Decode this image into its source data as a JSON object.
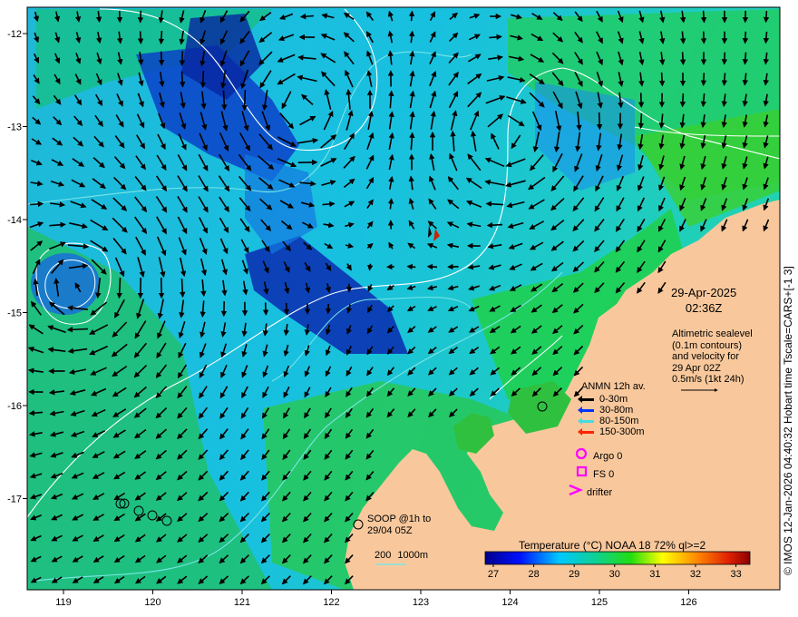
{
  "map": {
    "x_ticks": [
      "119",
      "120",
      "121",
      "122",
      "123",
      "124",
      "125",
      "126"
    ],
    "y_ticks": [
      "-12",
      "-13",
      "-14",
      "-15",
      "-16",
      "-17"
    ]
  },
  "date": {
    "day": "29-Apr-2025",
    "time": "02:36Z"
  },
  "altimetry_note": [
    "Altimetric sealevel",
    "(0.1m contours)",
    "and velocity for",
    "29 Apr 02Z",
    "0.5m/s (1kt 24h)"
  ],
  "anmn_legend": {
    "title": "ANMN 12h av.",
    "items": [
      {
        "label": "0-30m",
        "color": "#000000"
      },
      {
        "label": "30-80m",
        "color": "#0033ff"
      },
      {
        "label": "80-150m",
        "color": "#44dddd"
      },
      {
        "label": "150-300m",
        "color": "#ff2200"
      }
    ]
  },
  "markers": {
    "argo": "Argo 0",
    "fs": "FS 0",
    "drifter": "drifter",
    "color": "#ff00ff"
  },
  "soop": [
    "SOOP @1h to",
    "29/04 05Z"
  ],
  "isobath": {
    "a": "200",
    "b": "1000m"
  },
  "colorbar": {
    "title": "Temperature (°C) NOAA 18 72% ql>=2",
    "ticks": [
      "27",
      "28",
      "29",
      "30",
      "31",
      "32",
      "33"
    ]
  },
  "credit": "© IMOS 12-Jan-2026 04:40:32 Hobart time Tscale=CARS+[-1 3]",
  "colors": {
    "land": "#f8c89c",
    "shelf_contour": "#7ae6e6",
    "ssh_contour": "#ffffff"
  }
}
